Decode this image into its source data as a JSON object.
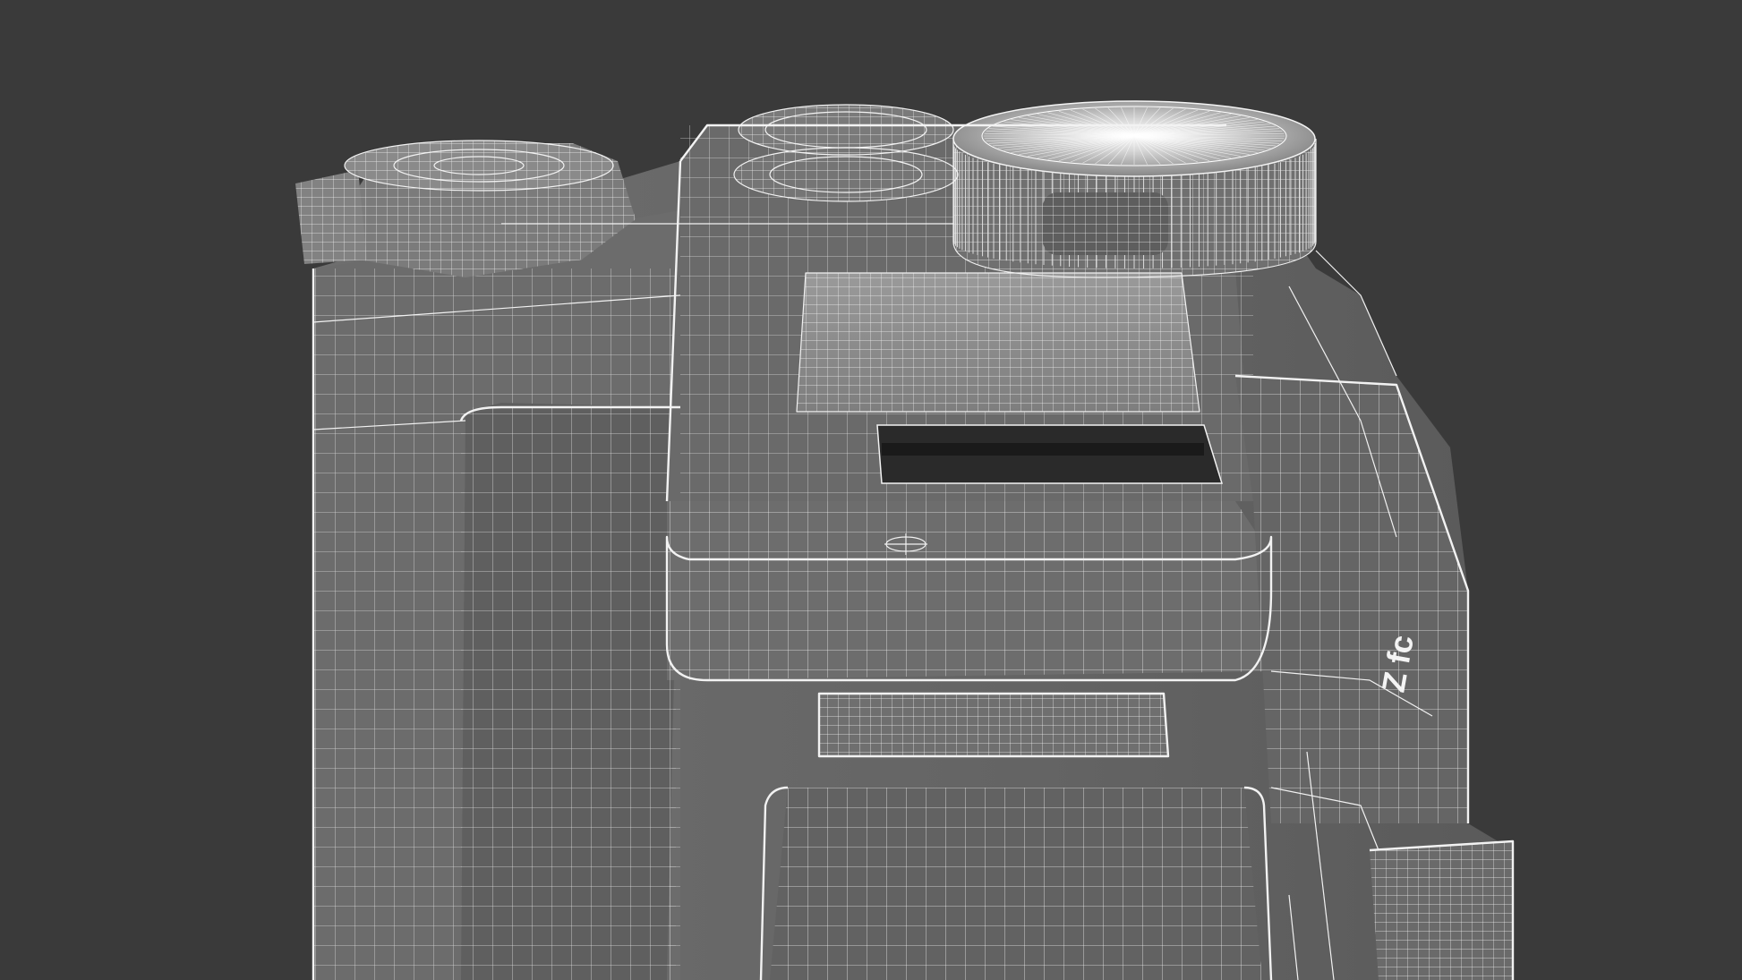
{
  "scene": {
    "background_color": "#3a3a3a",
    "body_color": "#6a6a6a",
    "body_dark_color": "#4e4e4e",
    "wire_color": "#f2f2f2",
    "model_text": "Z fc",
    "parts": {
      "left_dial": "left-dial",
      "top_dial": "top-dial",
      "right_knurled_dial": "knurled-dial",
      "hot_shoe": "hot-shoe",
      "viewfinder_hump": "viewfinder-hump",
      "eyepiece": "eyepiece",
      "grip": "grip",
      "lens_mount_side": "lens-side"
    }
  }
}
